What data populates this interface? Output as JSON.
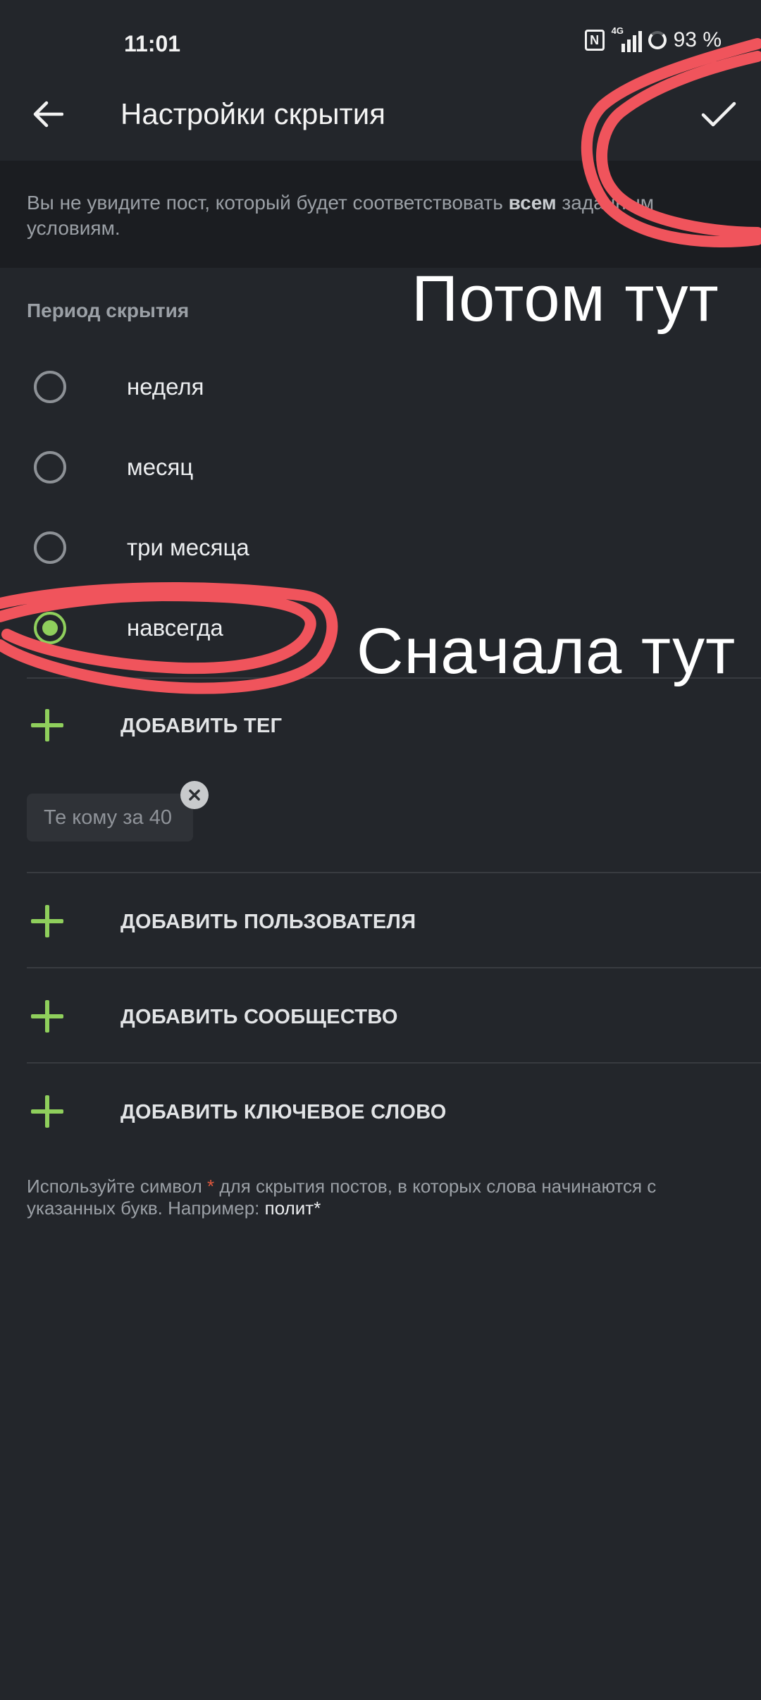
{
  "status_bar": {
    "time": "11:01",
    "network": "4G",
    "battery": "93 %"
  },
  "header": {
    "title": "Настройки скрытия",
    "back_icon": "arrow-left-icon",
    "confirm_icon": "check-icon"
  },
  "info_banner": {
    "text_before": "Вы не увидите пост, который будет соответствовать ",
    "text_bold": "всем",
    "text_after": " заданным условиям."
  },
  "period": {
    "label": "Период скрытия",
    "options": [
      {
        "label": "неделя",
        "checked": false
      },
      {
        "label": "месяц",
        "checked": false
      },
      {
        "label": "три месяца",
        "checked": false
      },
      {
        "label": "навсегда",
        "checked": true
      }
    ]
  },
  "actions": {
    "add_tag": "ДОБАВИТЬ ТЕГ",
    "add_user": "ДОБАВИТЬ ПОЛЬЗОВАТЕЛЯ",
    "add_community": "ДОБАВИТЬ СООБЩЕСТВО",
    "add_keyword": "ДОБАВИТЬ КЛЮЧЕВОЕ СЛОВО"
  },
  "tags": [
    {
      "label": "Те кому за 40"
    }
  ],
  "hint": {
    "part1": "Используйте символ ",
    "star": "*",
    "part2": " для скрытия постов, в которых слова начинаются с указанных букв. Например: ",
    "example": "полит*"
  },
  "annotations": {
    "first": "Сначала тут",
    "then": "Потом тут",
    "color": "#f0545c"
  },
  "colors": {
    "accent": "#8fcf5c",
    "background": "#23262b",
    "banner": "#1b1d21"
  }
}
